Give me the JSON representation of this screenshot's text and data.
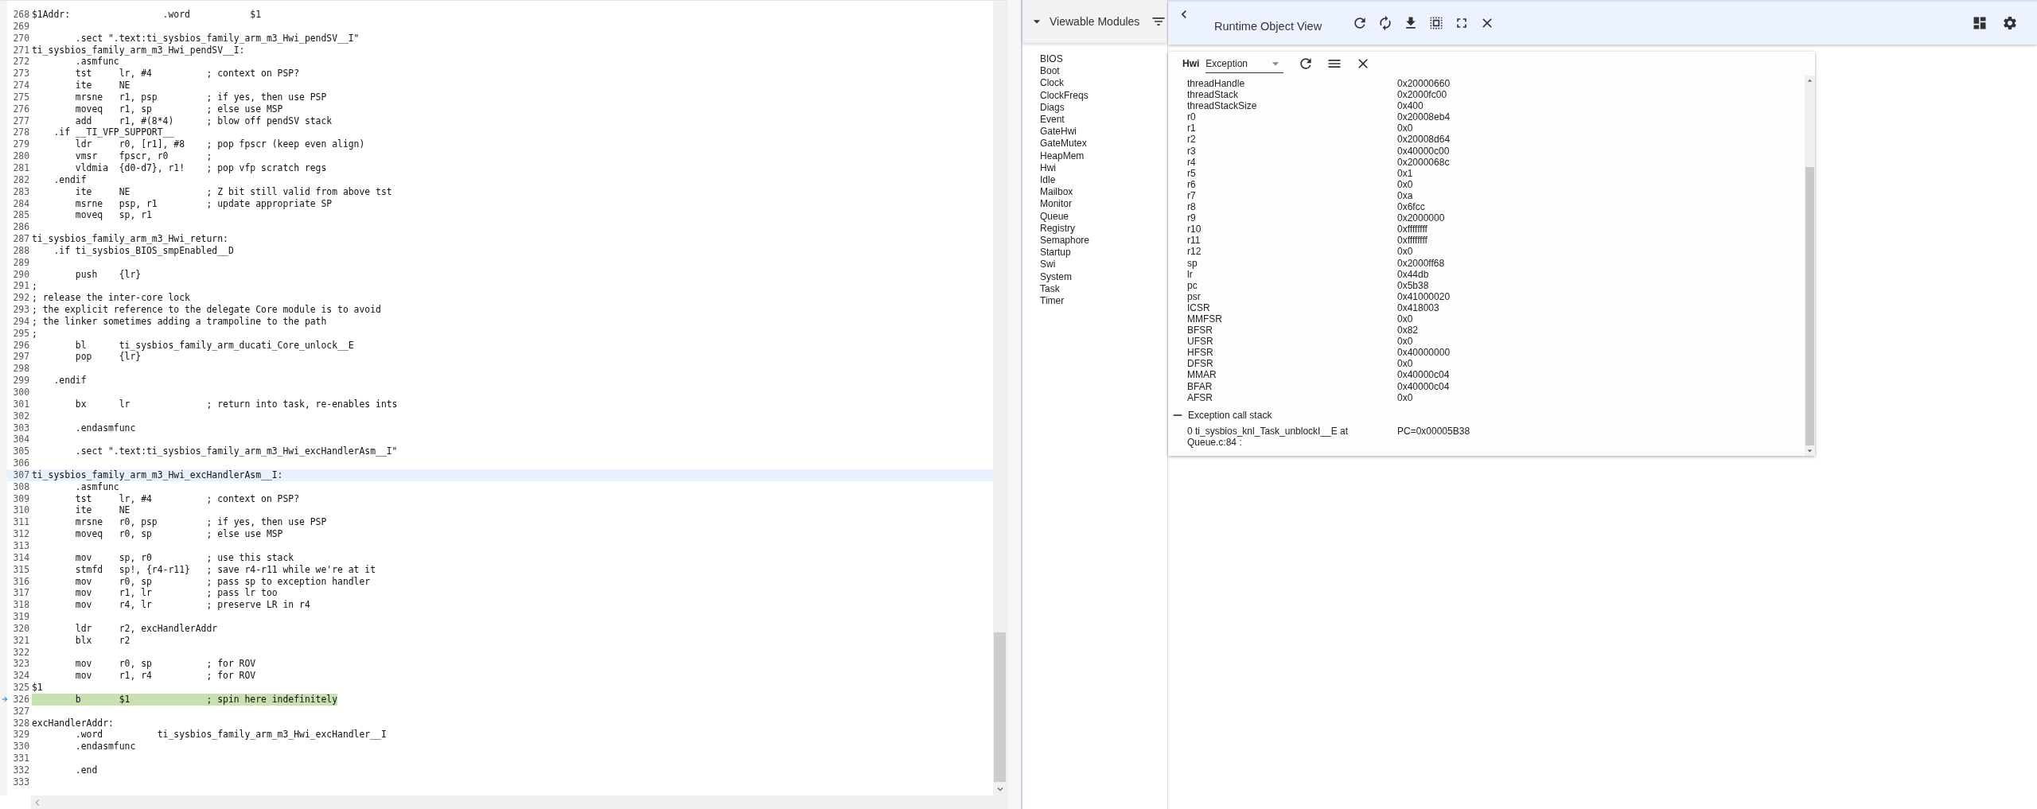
{
  "editor": {
    "lines": [
      {
        "number": "268",
        "text": "$1Addr:                 .word           $1",
        "kind": "plain"
      },
      {
        "number": "269",
        "kind": "plain"
      },
      {
        "number": "270",
        "text": "        .sect \".text:ti_sysbios_family_arm_m3_Hwi_pendSV__I\"",
        "kind": "plain"
      },
      {
        "number": "271",
        "text": "ti_sysbios_family_arm_m3_Hwi_pendSV__I:",
        "kind": "plain"
      },
      {
        "number": "272",
        "text": "        .asmfunc",
        "kind": "plain"
      },
      {
        "number": "273",
        "text": "        tst     lr, #4          ; context on PSP?",
        "kind": "plain"
      },
      {
        "number": "274",
        "text": "        ite     NE",
        "kind": "plain"
      },
      {
        "number": "275",
        "text": "        mrsne   r1, psp         ; if yes, then use PSP",
        "kind": "plain"
      },
      {
        "number": "276",
        "text": "        moveq   r1, sp          ; else use MSP",
        "kind": "plain"
      },
      {
        "number": "277",
        "text": "        add     r1, #(8*4)      ; blow off pendSV stack",
        "kind": "plain"
      },
      {
        "number": "278",
        "text": "    .if __TI_VFP_SUPPORT__",
        "kind": "plain"
      },
      {
        "number": "279",
        "text": "        ldr     r0, [r1], #8    ; pop fpscr (keep even align)",
        "kind": "plain"
      },
      {
        "number": "280",
        "text": "        vmsr    fpscr, r0       ;",
        "kind": "plain"
      },
      {
        "number": "281",
        "text": "        vldmia  {d0-d7}, r1!    ; pop vfp scratch regs",
        "kind": "plain"
      },
      {
        "number": "282",
        "text": "    .endif",
        "kind": "plain"
      },
      {
        "number": "283",
        "text": "        ite     NE              ; Z bit still valid from above tst",
        "kind": "plain"
      },
      {
        "number": "284",
        "text": "        msrne   psp, r1         ; update appropriate SP",
        "kind": "plain"
      },
      {
        "number": "285",
        "text": "        moveq   sp, r1",
        "kind": "plain"
      },
      {
        "number": "286",
        "kind": "plain"
      },
      {
        "number": "287",
        "text": "ti_sysbios_family_arm_m3_Hwi_return:",
        "kind": "plain"
      },
      {
        "number": "288",
        "text": "    .if ti_sysbios_BIOS_smpEnabled__D",
        "kind": "plain"
      },
      {
        "number": "289",
        "kind": "plain"
      },
      {
        "number": "290",
        "text": "        push    {lr}",
        "kind": "plain"
      },
      {
        "number": "291",
        "text": ";",
        "kind": "plain"
      },
      {
        "number": "292",
        "text": "; release the inter-core lock",
        "kind": "plain"
      },
      {
        "number": "293",
        "text": "; the explicit reference to the delegate Core module is to avoid",
        "kind": "plain"
      },
      {
        "number": "294",
        "text": "; the linker sometimes adding a trampoline to the path",
        "kind": "plain"
      },
      {
        "number": "295",
        "text": ";",
        "kind": "plain"
      },
      {
        "number": "296",
        "text": "        bl      ti_sysbios_family_arm_ducati_Core_unlock__E",
        "kind": "plain"
      },
      {
        "number": "297",
        "text": "        pop     {lr}",
        "kind": "plain"
      },
      {
        "number": "298",
        "kind": "plain"
      },
      {
        "number": "299",
        "text": "    .endif",
        "kind": "plain"
      },
      {
        "number": "300",
        "kind": "plain"
      },
      {
        "number": "301",
        "text": "        bx      lr              ; return into task, re-enables ints",
        "kind": "plain"
      },
      {
        "number": "302",
        "kind": "plain"
      },
      {
        "number": "303",
        "text": "        .endasmfunc",
        "kind": "plain"
      },
      {
        "number": "304",
        "kind": "plain"
      },
      {
        "number": "305",
        "text": "        .sect \".text:ti_sysbios_family_arm_m3_Hwi_excHandlerAsm__I\"",
        "kind": "plain"
      },
      {
        "number": "306",
        "kind": "plain"
      },
      {
        "number": "307",
        "text": "ti_sysbios_family_arm_m3_Hwi_excHandlerAsm__I:",
        "kind": "cursor"
      },
      {
        "number": "308",
        "text": "        .asmfunc",
        "kind": "plain"
      },
      {
        "number": "309",
        "text": "        tst     lr, #4          ; context on PSP?",
        "kind": "plain"
      },
      {
        "number": "310",
        "text": "        ite     NE",
        "kind": "plain"
      },
      {
        "number": "311",
        "text": "        mrsne   r0, psp         ; if yes, then use PSP",
        "kind": "plain"
      },
      {
        "number": "312",
        "text": "        moveq   r0, sp          ; else use MSP",
        "kind": "plain"
      },
      {
        "number": "313",
        "kind": "plain"
      },
      {
        "number": "314",
        "text": "        mov     sp, r0          ; use this stack",
        "kind": "plain"
      },
      {
        "number": "315",
        "text": "        stmfd   sp!, {r4-r11}   ; save r4-r11 while we're at it",
        "kind": "plain"
      },
      {
        "number": "316",
        "text": "        mov     r0, sp          ; pass sp to exception handler",
        "kind": "plain"
      },
      {
        "number": "317",
        "text": "        mov     r1, lr          ; pass lr too",
        "kind": "plain"
      },
      {
        "number": "318",
        "text": "        mov     r4, lr          ; preserve LR in r4",
        "kind": "plain"
      },
      {
        "number": "319",
        "kind": "plain"
      },
      {
        "number": "320",
        "text": "        ldr     r2, excHandlerAddr",
        "kind": "plain"
      },
      {
        "number": "321",
        "text": "        blx     r2",
        "kind": "plain"
      },
      {
        "number": "322",
        "kind": "plain"
      },
      {
        "number": "323",
        "text": "        mov     r0, sp          ; for ROV",
        "kind": "plain"
      },
      {
        "number": "324",
        "text": "        mov     r1, r4          ; for ROV",
        "kind": "plain"
      },
      {
        "number": "325",
        "text": "$1",
        "kind": "plain"
      },
      {
        "number": "326",
        "text": "        b       $1              ; spin here indefinitely",
        "kind": "execution"
      },
      {
        "number": "327",
        "kind": "plain"
      },
      {
        "number": "328",
        "text": "excHandlerAddr:",
        "kind": "plain"
      },
      {
        "number": "329",
        "text": "        .word          ti_sysbios_family_arm_m3_Hwi_excHandler__I",
        "kind": "plain"
      },
      {
        "number": "330",
        "text": "        .endasmfunc",
        "kind": "plain"
      },
      {
        "number": "331",
        "kind": "plain"
      },
      {
        "number": "332",
        "text": "        .end",
        "kind": "plain"
      },
      {
        "number": "333",
        "kind": "plain"
      }
    ]
  },
  "modules_panel": {
    "title": "Viewable Modules",
    "expanded": true,
    "items": [
      "BIOS",
      "Boot",
      "Clock",
      "ClockFreqs",
      "Diags",
      "Event",
      "GateHwi",
      "GateMutex",
      "HeapMem",
      "Hwi",
      "Idle",
      "Mailbox",
      "Monitor",
      "Queue",
      "Registry",
      "Semaphore",
      "Startup",
      "Swi",
      "System",
      "Task",
      "Timer"
    ]
  },
  "rov": {
    "title": "Runtime Object View",
    "view": {
      "module": "Hwi",
      "selection": "Exception",
      "fields": [
        {
          "name": "threadHandle",
          "value": "0x20000660"
        },
        {
          "name": "threadStack",
          "value": "0x2000fc00"
        },
        {
          "name": "threadStackSize",
          "value": "0x400"
        },
        {
          "name": "r0",
          "value": "0x20008eb4"
        },
        {
          "name": "r1",
          "value": "0x0"
        },
        {
          "name": "r2",
          "value": "0x20008d64"
        },
        {
          "name": "r3",
          "value": "0x40000c00"
        },
        {
          "name": "r4",
          "value": "0x2000068c"
        },
        {
          "name": "r5",
          "value": "0x1"
        },
        {
          "name": "r6",
          "value": "0x0"
        },
        {
          "name": "r7",
          "value": "0xa"
        },
        {
          "name": "r8",
          "value": "0x6fcc"
        },
        {
          "name": "r9",
          "value": "0x2000000"
        },
        {
          "name": "r10",
          "value": "0xffffffff"
        },
        {
          "name": "r11",
          "value": "0xffffffff"
        },
        {
          "name": "r12",
          "value": "0x0"
        },
        {
          "name": "sp",
          "value": "0x2000ff68"
        },
        {
          "name": "lr",
          "value": "0x44db"
        },
        {
          "name": "pc",
          "value": "0x5b38"
        },
        {
          "name": "psr",
          "value": "0x41000020"
        },
        {
          "name": "ICSR",
          "value": "0x418003"
        },
        {
          "name": "MMFSR",
          "value": "0x0"
        },
        {
          "name": "BFSR",
          "value": "0x82"
        },
        {
          "name": "UFSR",
          "value": "0x0"
        },
        {
          "name": "HFSR",
          "value": "0x40000000"
        },
        {
          "name": "DFSR",
          "value": "0x0"
        },
        {
          "name": "MMAR",
          "value": "0x40000c04"
        },
        {
          "name": "BFAR",
          "value": "0x40000c04"
        },
        {
          "name": "AFSR",
          "value": "0x0"
        }
      ],
      "call_stack": {
        "title": "Exception call stack",
        "expanded": true,
        "frames": [
          {
            "location": "0 ti_sysbios_knl_Task_unblockI__E at Queue.c:84 :",
            "pc": "PC=0x00005B38"
          }
        ]
      }
    }
  }
}
